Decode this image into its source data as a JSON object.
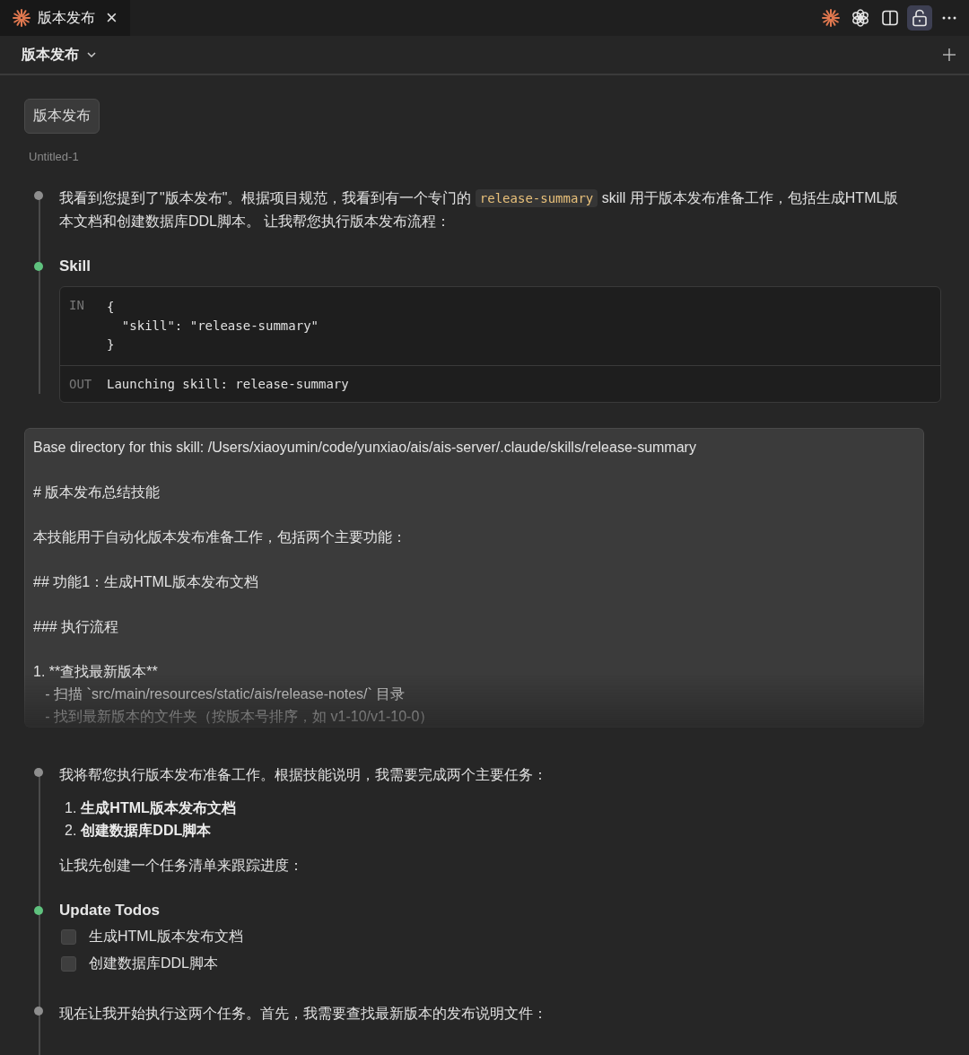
{
  "tab": {
    "title": "版本发布",
    "close": "×"
  },
  "header": {
    "title": "版本发布"
  },
  "prompt": {
    "text": "版本发布",
    "file": "Untitled-1"
  },
  "messages": [
    {
      "kind": "text",
      "color": "#8e8e8e",
      "blocks": [
        {
          "kind": "para",
          "segments": [
            {
              "kind": "plain",
              "text": "我看到您提到了\"版本发布\"。根据项目规范，我看到有一个专门的 "
            },
            {
              "kind": "code",
              "text": "release-summary"
            },
            {
              "kind": "plain",
              "text": " skill 用于版本发布准备工作，包括生成HTML版本文档和创建数据库DDL脚本。 让我帮您执行版本发布流程："
            }
          ]
        }
      ]
    },
    {
      "kind": "tool",
      "color": "#5fc27e",
      "name": "Skill",
      "input_label": "IN",
      "input": [
        "{",
        "  \"skill\": \"release-summary\"",
        "}"
      ],
      "output_label": "OUT",
      "output": "Launching skill: release-summary"
    },
    {
      "kind": "result",
      "paragraphs": [
        [
          "Base directory for this skill: /Users/xiaoyumin/code/yunxiao/ais/ais-server/.claude/skills/release-summary"
        ],
        [
          "# 版本发布总结技能"
        ],
        [
          "本技能用于自动化版本发布准备工作，包括两个主要功能："
        ],
        [
          "## 功能1：生成HTML版本发布文档"
        ],
        [
          "### 执行流程"
        ],
        [
          "1. **查找最新版本**",
          "   - 扫描 `src/main/resources/static/ais/release-notes/` 目录",
          "   - 找到最新版本的文件夹（按版本号排序，如 v1-10/v1-10-0）"
        ]
      ]
    },
    {
      "kind": "text",
      "color": "#8e8e8e",
      "blocks": [
        {
          "kind": "para",
          "segments": [
            {
              "kind": "plain",
              "text": "我将帮您执行版本发布准备工作。根据技能说明，我需要完成两个主要任务："
            }
          ]
        },
        {
          "kind": "list",
          "items": [
            {
              "number": "1.",
              "text": "生成HTML版本发布文档"
            },
            {
              "number": "2.",
              "text": "创建数据库DDL脚本"
            }
          ]
        },
        {
          "kind": "para",
          "segments": [
            {
              "kind": "plain",
              "text": "让我先创建一个任务清单来跟踪进度："
            }
          ]
        }
      ]
    },
    {
      "kind": "todos",
      "color": "#5fc27e",
      "title": "Update Todos",
      "items": [
        {
          "text": "生成HTML版本发布文档",
          "checked": false
        },
        {
          "text": "创建数据库DDL脚本",
          "checked": false
        }
      ]
    },
    {
      "kind": "text",
      "color": "#8e8e8e",
      "blocks": [
        {
          "kind": "para",
          "segments": [
            {
              "kind": "plain",
              "text": "现在让我开始执行这两个任务。首先，我需要查找最新版本的发布说明文件："
            }
          ]
        }
      ]
    }
  ]
}
